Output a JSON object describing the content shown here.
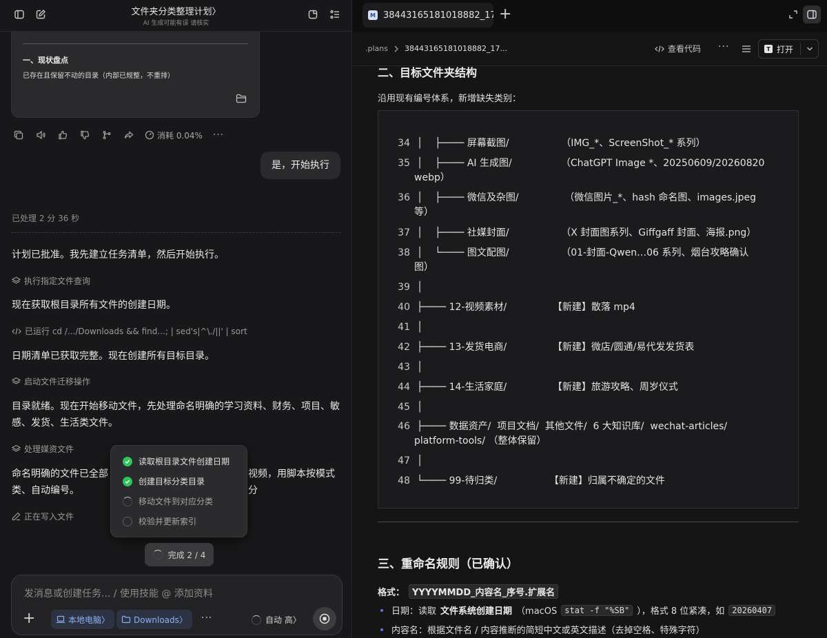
{
  "left": {
    "header": {
      "title": "文件夹分类整理计划〉",
      "subtitle": "AI 生成可能有误 请核实"
    },
    "card": {
      "heading": "一、现状盘点",
      "paragraph": "已存在且保留不动的目录（内部已规整，不重排）"
    },
    "actions": {
      "cost_label": "消耗 0.04%"
    },
    "user_message": "是，开始执行",
    "processed": "已处理 2 分 36 秒",
    "messages": [
      "计划已批准。我先建立任务清单，然后开始执行。",
      "现在获取根目录所有文件的创建日期。",
      "日期清单已获取完整。现在创建所有目标目录。",
      "目录就绪。现在开始移动文件，先处理命名明确的学习资料、财务、项目、敏感、发货、生活类文件。",
      "命名明确的文件已全部",
      "视频，用脚本按模式分",
      "类、自动编号。"
    ],
    "tools": [
      "执行指定文件查询",
      "已运行 cd /.../Downloads && find...; | sed's|^\\./||' | sort",
      "启动文件迁移操作",
      "处理媒资文件",
      "正在写入文件"
    ],
    "tasks": [
      {
        "label": "读取根目录文件创建日期",
        "status": "done"
      },
      {
        "label": "创建目标分类目录",
        "status": "done"
      },
      {
        "label": "移动文件到对应分类",
        "status": "running"
      },
      {
        "label": "校验并更新索引",
        "status": "pending"
      }
    ],
    "progress_label": "完成 2 / 4",
    "composer": {
      "placeholder": "发消息或创建任务... / 使用技能 @ 添加资料",
      "chip_local": "本地电脑〉",
      "chip_folder": "Downloads〉",
      "mode": "自动 高〉"
    }
  },
  "right": {
    "tab": {
      "name": "38443165181018882_17"
    },
    "breadcrumb": {
      "root": ".plans",
      "current": "38443165181018882_17..."
    },
    "toolbar": {
      "view_code": "查看代码",
      "open": "打开"
    },
    "section2_heading_cut": "二、目标文件夹结构",
    "intro": "沿用现有编号体系，新增缺失类别：",
    "code_lines": [
      {
        "n": "34",
        "text": "│    ├──── 屏幕截图/                 （IMG_*、ScreenShot_* 系列）"
      },
      {
        "n": "35",
        "text": "│    ├──── AI 生成图/                （ChatGPT Image *、20250609/20260820",
        "wrap": "webp）"
      },
      {
        "n": "36",
        "text": "│    ├──── 微信及杂图/               （微信图片_*、hash 命名图、images.jpeg",
        "wrap": "等）"
      },
      {
        "n": "37",
        "text": "│    ├──── 社媒封面/                 （X 封面图系列、Giffgaff 封面、海报.png）"
      },
      {
        "n": "38",
        "text": "│    └──── 图文配图/                 （01-封面-Qwen…06 系列、烟台攻略确认",
        "wrap": "图）"
      },
      {
        "n": "39",
        "text": "│"
      },
      {
        "n": "40",
        "text": "├──── 12-视频素材/               【新建】散落 mp4"
      },
      {
        "n": "41",
        "text": "│"
      },
      {
        "n": "42",
        "text": "├──── 13-发货电商/               【新建】微店/圆通/易代发发货表"
      },
      {
        "n": "43",
        "text": "│"
      },
      {
        "n": "44",
        "text": "├──── 14-生活家庭/               【新建】旅游攻略、周岁仪式"
      },
      {
        "n": "45",
        "text": "│"
      },
      {
        "n": "46",
        "text": "├──── 数据资产/  项目文档/  其他文件/  6 大知识库/  wechat-articles/",
        "wrap": "platform-tools/   （整体保留）"
      },
      {
        "n": "47",
        "text": "│"
      },
      {
        "n": "48",
        "text": "└──── 99-待归类/                 【新建】归属不确定的文件"
      }
    ],
    "section3_heading": "三、重命名规则（已确认）",
    "format": {
      "label": "格式：",
      "pattern": "YYYYMMDD_内容名_序号.扩展名"
    },
    "bullets": [
      {
        "prefix": "日期：读取",
        "bold": "文件系统创建日期",
        "mid": "（macOS",
        "code": "stat -f \"%SB\"",
        "suffix": "），格式 8 位紧凑，如",
        "code2": "20260407"
      },
      {
        "prefix": "内容名：根据文件名 / 内容推断的简短中文或英文描述（去掉空格、特殊字符）"
      }
    ]
  }
}
